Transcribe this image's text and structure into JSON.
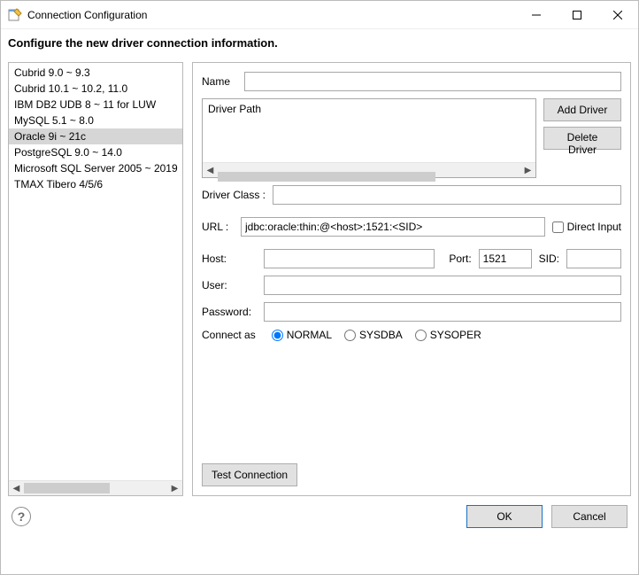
{
  "window": {
    "title": "Connection Configuration",
    "subtitle": "Configure the new driver connection information."
  },
  "drivers": [
    "Cubrid 9.0 ~ 9.3",
    "Cubrid 10.1 ~ 10.2, 11.0",
    "IBM DB2 UDB 8 ~ 11 for LUW",
    "MySQL 5.1 ~ 8.0",
    "Oracle 9i ~ 21c",
    "PostgreSQL 9.0 ~ 14.0",
    "Microsoft SQL Server 2005 ~ 2019",
    "TMAX Tibero 4/5/6"
  ],
  "selected_driver_index": 4,
  "form": {
    "name_label": "Name",
    "name_value": "",
    "driver_path_label": "Driver Path",
    "add_driver_label": "Add Driver",
    "delete_driver_label": "Delete Driver",
    "driver_class_label": "Driver Class :",
    "driver_class_value": "",
    "url_label": "URL :",
    "url_value": "jdbc:oracle:thin:@<host>:1521:<SID>",
    "direct_input_label": "Direct Input",
    "direct_input_checked": false,
    "host_label": "Host:",
    "host_value": "",
    "port_label": "Port:",
    "port_value": "1521",
    "sid_label": "SID:",
    "sid_value": "",
    "user_label": "User:",
    "user_value": "",
    "password_label": "Password:",
    "password_value": "",
    "connect_as_label": "Connect as",
    "connect_as_options": [
      "NORMAL",
      "SYSDBA",
      "SYSOPER"
    ],
    "connect_as_selected": "NORMAL",
    "test_connection_label": "Test Connection"
  },
  "footer": {
    "ok_label": "OK",
    "cancel_label": "Cancel"
  }
}
